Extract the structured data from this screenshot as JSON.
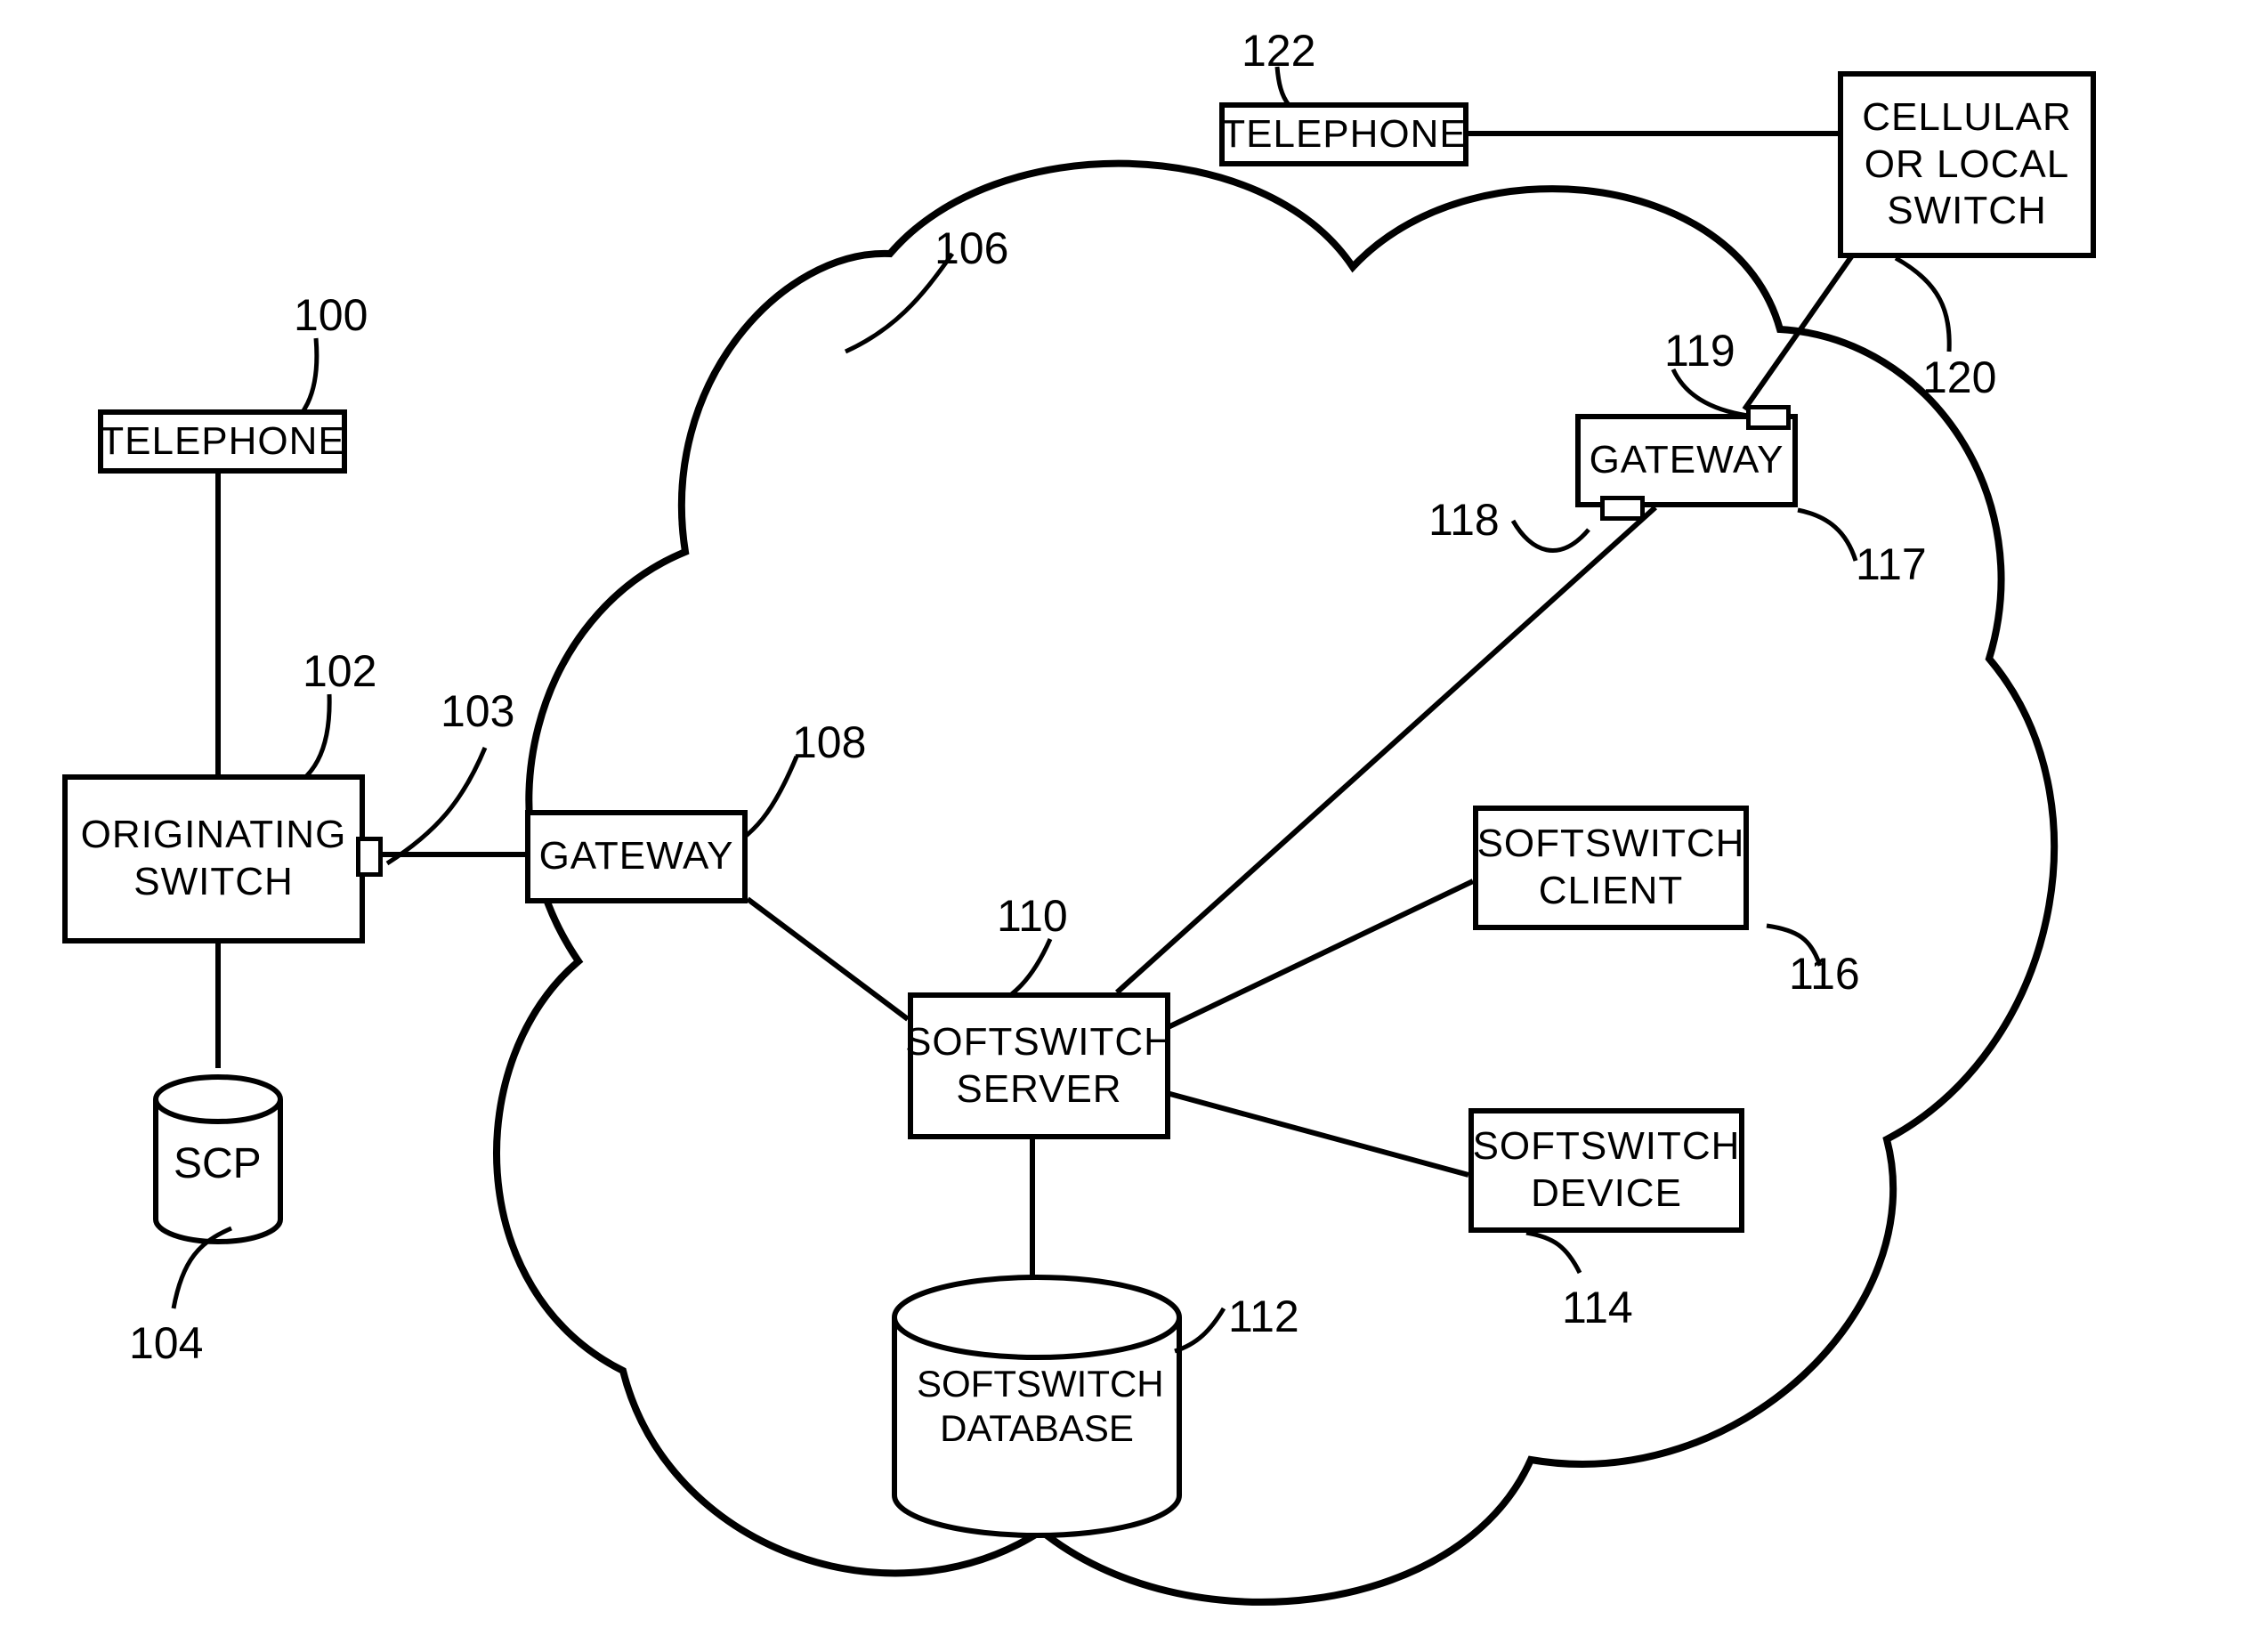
{
  "labels": {
    "telephone1": "TELEPHONE",
    "telephone2": "TELEPHONE",
    "originating_switch": "ORIGINATING\nSWITCH",
    "scp": "SCP",
    "gateway1": "GATEWAY",
    "gateway2": "GATEWAY",
    "softswitch_server": "SOFTSWITCH\nSERVER",
    "softswitch_database": "SOFTSWITCH\nDATABASE",
    "softswitch_client": "SOFTSWITCH\nCLIENT",
    "softswitch_device": "SOFTSWITCH\nDEVICE",
    "cellular_switch": "CELLULAR\nOR LOCAL\nSWITCH"
  },
  "refs": {
    "r100": "100",
    "r102": "102",
    "r103": "103",
    "r104": "104",
    "r106": "106",
    "r108": "108",
    "r110": "110",
    "r112": "112",
    "r114": "114",
    "r116": "116",
    "r117": "117",
    "r118": "118",
    "r119": "119",
    "r120": "120",
    "r122": "122"
  }
}
